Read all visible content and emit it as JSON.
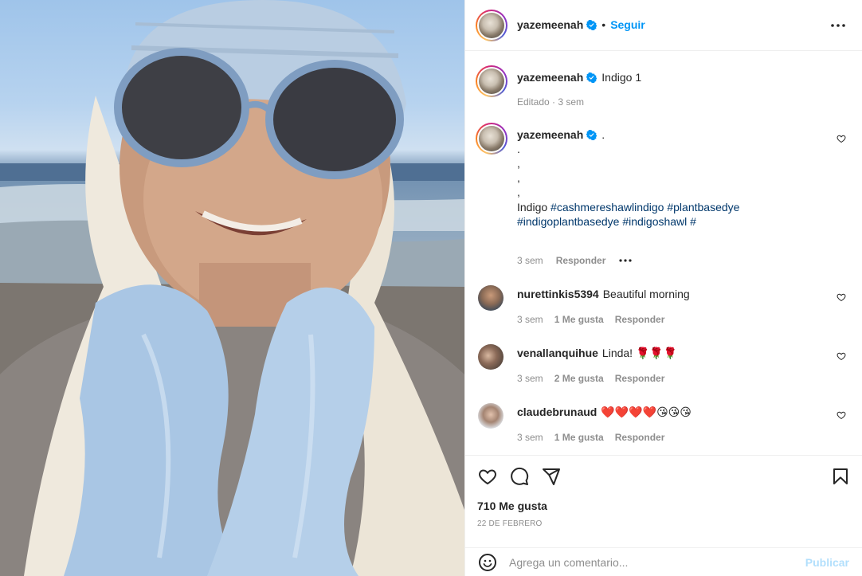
{
  "post": {
    "author": "yazemeenah",
    "follow_label": "Seguir",
    "more_icon": "more-horizontal-icon"
  },
  "caption": {
    "author": "yazemeenah",
    "text": "Indigo 1",
    "meta": "Editado · 3 sem"
  },
  "main_comment": {
    "author": "yazemeenah",
    "text": ".",
    "lines": [
      ".",
      ",",
      ",",
      ",",
      ","
    ],
    "body_start": "Indigo ",
    "hashtags_line1": "#cashmereshawlindigo #plantbasedye",
    "hashtags_line2": "#indigoplantbasedye #indigoshawl #",
    "time": "3 sem",
    "reply": "Responder"
  },
  "comments": [
    {
      "author": "nurettinkis5394",
      "text": "Beautiful morning",
      "time": "3 sem",
      "likes": "1 Me gusta",
      "reply": "Responder"
    },
    {
      "author": "venallanquihue",
      "text": "Linda! 🌹🌹🌹",
      "time": "3 sem",
      "likes": "2 Me gusta",
      "reply": "Responder"
    },
    {
      "author": "claudebrunaud",
      "text": "❤️❤️❤️❤️😘😘😘",
      "time": "3 sem",
      "likes": "1 Me gusta",
      "reply": "Responder"
    }
  ],
  "footer": {
    "likes": "710 Me gusta",
    "date": "22 DE FEBRERO",
    "comment_placeholder": "Agrega un comentario...",
    "publish": "Publicar"
  },
  "colors": {
    "accent": "#0095f6",
    "hashtag": "#00376b",
    "muted": "#8e8e8e",
    "publish_disabled": "#b2dffc"
  }
}
